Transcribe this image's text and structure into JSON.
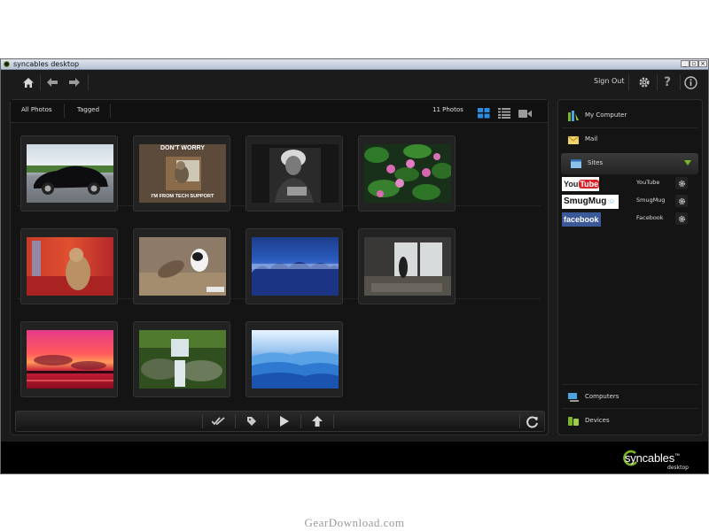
{
  "window": {
    "title": "syncables desktop"
  },
  "topbar": {
    "signout_label": "Sign Out"
  },
  "tabs": [
    {
      "label": "All Photos"
    },
    {
      "label": "Tagged"
    }
  ],
  "photo_count": "11 Photos",
  "thumbnails": [
    {
      "subject": "black sports car"
    },
    {
      "subject": "cat meme",
      "caption_top": "DON'T WORRY",
      "caption_bottom": "I'M FROM TECH SUPPORT"
    },
    {
      "subject": "einstein portrait"
    },
    {
      "subject": "pink water lilies"
    },
    {
      "subject": "squirrel on red"
    },
    {
      "subject": "dog and cat fighting"
    },
    {
      "subject": "blue winter trees"
    },
    {
      "subject": "person at window"
    },
    {
      "subject": "red sunset"
    },
    {
      "subject": "waterfall"
    },
    {
      "subject": "blue mountain layers"
    }
  ],
  "sidebar": {
    "items": [
      {
        "label": "My Computer",
        "icon": "my-computer-icon"
      },
      {
        "label": "Mail",
        "icon": "mail-icon"
      },
      {
        "label": "Sites",
        "icon": "sites-icon"
      },
      {
        "label": "Computers",
        "icon": "computers-icon"
      },
      {
        "label": "Devices",
        "icon": "devices-icon"
      }
    ],
    "sites": [
      {
        "name": "YouTube",
        "logo_text": "You",
        "logo_text2": "Tube"
      },
      {
        "name": "SmugMug",
        "logo_text": "SmugMug"
      },
      {
        "name": "Facebook",
        "logo_text": "facebook"
      }
    ]
  },
  "brand": {
    "name": "syncables",
    "tm": "™",
    "sub": "desktop"
  },
  "watermark": "GearDownload.com",
  "colors": {
    "accent": "#1e7fd2",
    "brand_green": "#7bb62a",
    "background": "#1b1b1b"
  }
}
